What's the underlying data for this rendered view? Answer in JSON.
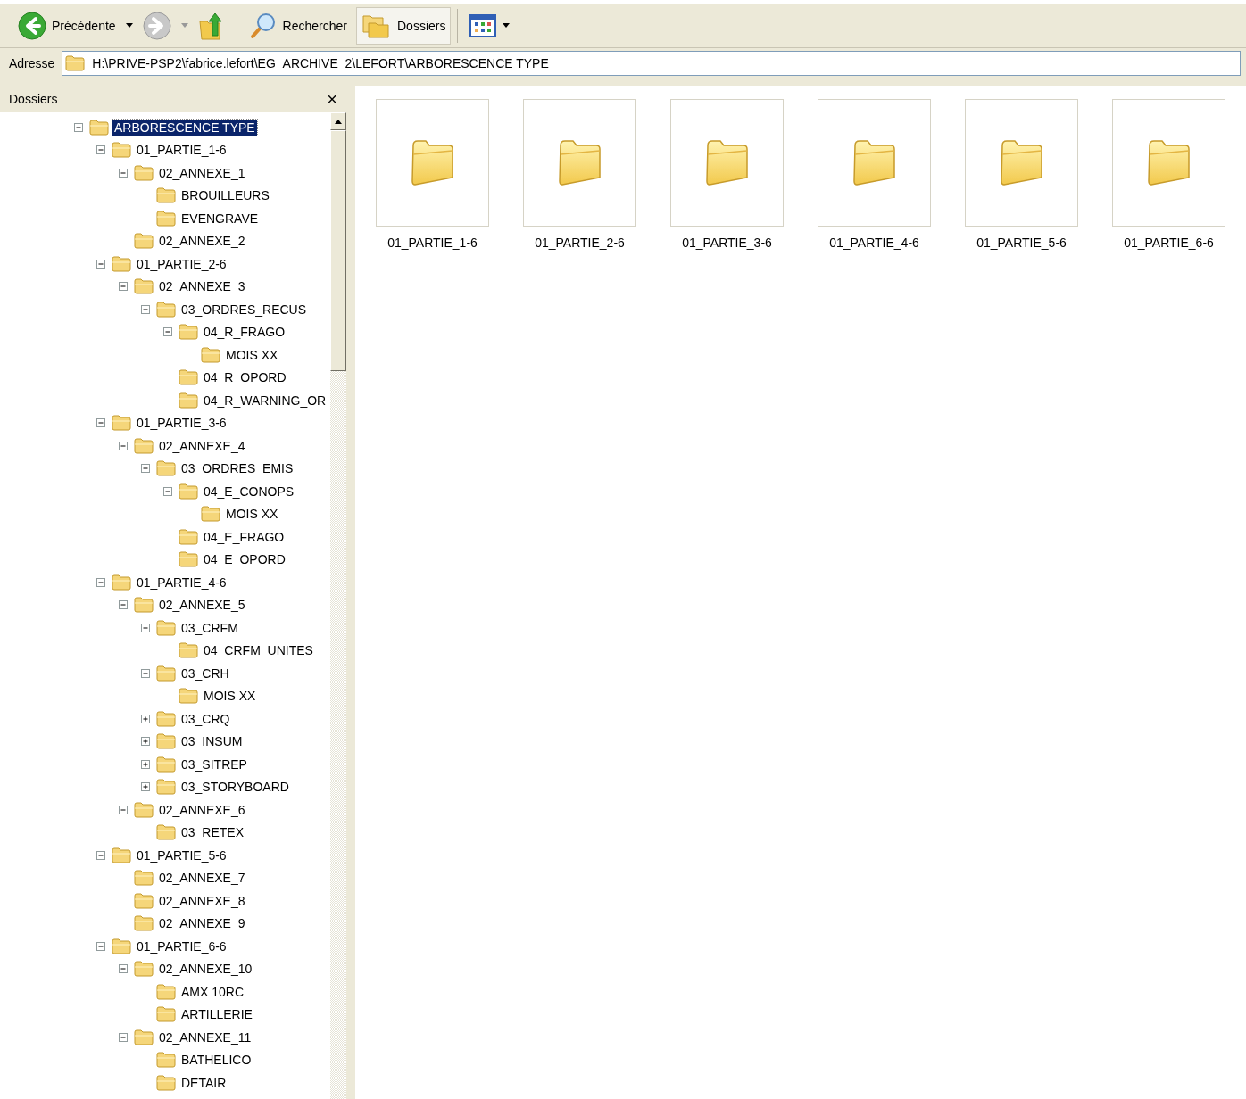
{
  "toolbar": {
    "back": {
      "label": "Précédente",
      "disabled": false
    },
    "forward": {
      "disabled": true
    },
    "search": {
      "label": "Rechercher"
    },
    "folders": {
      "label": "Dossiers",
      "selected": true
    }
  },
  "address_bar": {
    "label": "Adresse",
    "value": "H:\\PRIVE-PSP2\\fabrice.lefort\\EG_ARCHIVE_2\\LEFORT\\ARBORESCENCE TYPE"
  },
  "folders_pane": {
    "title": "Dossiers",
    "close": "×",
    "tree": [
      {
        "label": "ARBORESCENCE TYPE",
        "selected": true,
        "expanded": true,
        "children": [
          {
            "label": "01_PARTIE_1-6",
            "selected": false,
            "expanded": true,
            "children": [
              {
                "label": "02_ANNEXE_1",
                "selected": false,
                "expanded": true,
                "children": [
                  {
                    "label": "BROUILLEURS",
                    "selected": false
                  },
                  {
                    "label": "EVENGRAVE",
                    "selected": false
                  }
                ]
              },
              {
                "label": "02_ANNEXE_2",
                "selected": false
              }
            ]
          },
          {
            "label": "01_PARTIE_2-6",
            "selected": false,
            "expanded": true,
            "children": [
              {
                "label": "02_ANNEXE_3",
                "selected": false,
                "expanded": true,
                "children": [
                  {
                    "label": "03_ORDRES_RECUS",
                    "selected": false,
                    "expanded": true,
                    "children": [
                      {
                        "label": "04_R_FRAGO",
                        "selected": false,
                        "expanded": true,
                        "children": [
                          {
                            "label": "MOIS XX",
                            "selected": false
                          }
                        ]
                      },
                      {
                        "label": "04_R_OPORD",
                        "selected": false
                      },
                      {
                        "label": "04_R_WARNING_OR",
                        "selected": false
                      }
                    ]
                  }
                ]
              }
            ]
          },
          {
            "label": "01_PARTIE_3-6",
            "selected": false,
            "expanded": true,
            "children": [
              {
                "label": "02_ANNEXE_4",
                "selected": false,
                "expanded": true,
                "children": [
                  {
                    "label": "03_ORDRES_EMIS",
                    "selected": false,
                    "expanded": true,
                    "children": [
                      {
                        "label": "04_E_CONOPS",
                        "selected": false,
                        "expanded": true,
                        "children": [
                          {
                            "label": "MOIS XX",
                            "selected": false
                          }
                        ]
                      },
                      {
                        "label": "04_E_FRAGO",
                        "selected": false
                      },
                      {
                        "label": "04_E_OPORD",
                        "selected": false
                      }
                    ]
                  }
                ]
              }
            ]
          },
          {
            "label": "01_PARTIE_4-6",
            "selected": false,
            "expanded": true,
            "children": [
              {
                "label": "02_ANNEXE_5",
                "selected": false,
                "expanded": true,
                "children": [
                  {
                    "label": "03_CRFM",
                    "selected": false,
                    "expanded": true,
                    "children": [
                      {
                        "label": "04_CRFM_UNITES",
                        "selected": false
                      }
                    ]
                  },
                  {
                    "label": "03_CRH",
                    "selected": false,
                    "expanded": true,
                    "children": [
                      {
                        "label": "MOIS XX",
                        "selected": false
                      }
                    ]
                  },
                  {
                    "label": "03_CRQ",
                    "selected": false,
                    "expanded": false
                  },
                  {
                    "label": "03_INSUM",
                    "selected": false,
                    "expanded": false
                  },
                  {
                    "label": "03_SITREP",
                    "selected": false,
                    "expanded": false
                  },
                  {
                    "label": "03_STORYBOARD",
                    "selected": false,
                    "expanded": false
                  }
                ]
              },
              {
                "label": "02_ANNEXE_6",
                "selected": false,
                "expanded": true,
                "children": [
                  {
                    "label": "03_RETEX",
                    "selected": false
                  }
                ]
              }
            ]
          },
          {
            "label": "01_PARTIE_5-6",
            "selected": false,
            "expanded": true,
            "children": [
              {
                "label": "02_ANNEXE_7",
                "selected": false
              },
              {
                "label": "02_ANNEXE_8",
                "selected": false
              },
              {
                "label": "02_ANNEXE_9",
                "selected": false
              }
            ]
          },
          {
            "label": "01_PARTIE_6-6",
            "selected": false,
            "expanded": true,
            "children": [
              {
                "label": "02_ANNEXE_10",
                "selected": false,
                "expanded": true,
                "children": [
                  {
                    "label": "AMX 10RC",
                    "selected": false
                  },
                  {
                    "label": "ARTILLERIE",
                    "selected": false
                  }
                ]
              },
              {
                "label": "02_ANNEXE_11",
                "selected": false,
                "expanded": true,
                "children": [
                  {
                    "label": "BATHELICO",
                    "selected": false
                  },
                  {
                    "label": "DETAIR",
                    "selected": false
                  }
                ]
              }
            ]
          }
        ]
      }
    ]
  },
  "content": {
    "items": [
      {
        "label": "01_PARTIE_1-6",
        "selected": false
      },
      {
        "label": "01_PARTIE_2-6",
        "selected": false
      },
      {
        "label": "01_PARTIE_3-6",
        "selected": false
      },
      {
        "label": "01_PARTIE_4-6",
        "selected": false
      },
      {
        "label": "01_PARTIE_5-6",
        "selected": false
      },
      {
        "label": "01_PARTIE_6-6",
        "selected": false
      }
    ]
  }
}
